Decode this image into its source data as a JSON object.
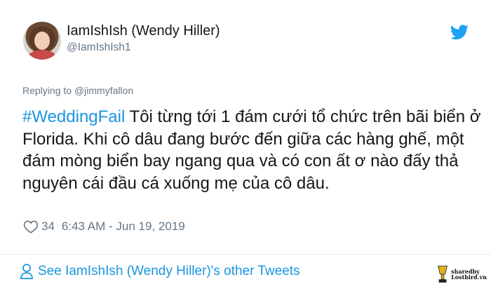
{
  "tweet": {
    "author": {
      "display_name": "IamIshIsh (Wendy Hiller)",
      "handle": "@IamIshIsh1",
      "avatar_icon": "profile-photo"
    },
    "platform_icon": "twitter-bird-icon",
    "reply_prefix": "Replying to",
    "reply_to": "@jimmyfallon",
    "hashtag": "#WeddingFail",
    "text": " Tôi từng tới 1 đám cưới tổ chức trên bãi biển ở Florida. Khi cô dâu đang bước đến giữa các hàng ghế, một đám mòng biển bay ngang qua và có con ất ơ nào đấy thả nguyên cái đầu cá xuống mẹ của cô dâu.",
    "like_count": "34",
    "timestamp": "6:43 AM - Jun 19, 2019",
    "footer_link": "See IamIshIsh (Wendy Hiller)'s other Tweets"
  },
  "watermark": {
    "line1": "sharedby",
    "line2": "Lostbird.vn"
  },
  "colors": {
    "accent": "#1b95e0",
    "text": "#14171a",
    "muted": "#657786",
    "divider": "#e6ecf0"
  }
}
